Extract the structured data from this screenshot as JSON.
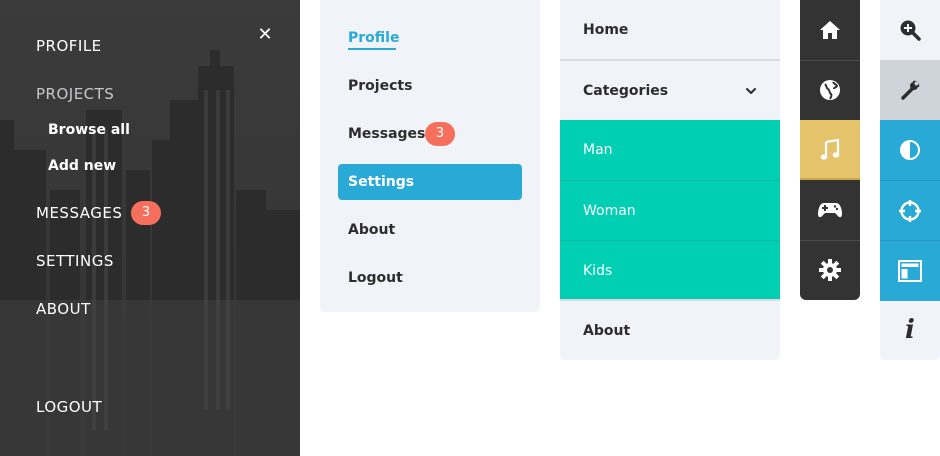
{
  "panel1": {
    "close_icon": "close-icon",
    "items": [
      {
        "label": "PROFILE"
      },
      {
        "label": "PROJECTS"
      },
      {
        "label": "MESSAGES",
        "badge": "3"
      },
      {
        "label": "SETTINGS"
      },
      {
        "label": "ABOUT"
      },
      {
        "label": "LOGOUT"
      }
    ],
    "sub_items": [
      {
        "label": "Browse all"
      },
      {
        "label": "Add new"
      }
    ]
  },
  "panel2": {
    "items": [
      {
        "label": "Profile",
        "state": "active"
      },
      {
        "label": "Projects"
      },
      {
        "label": "Messages",
        "badge": "3"
      },
      {
        "label": "Settings",
        "state": "selected"
      },
      {
        "label": "About"
      },
      {
        "label": "Logout"
      }
    ]
  },
  "panel3": {
    "items": [
      {
        "label": "Home"
      },
      {
        "label": "Categories",
        "icon": "chevron-down-icon"
      },
      {
        "label": "Man"
      },
      {
        "label": "Woman"
      },
      {
        "label": "Kids"
      },
      {
        "label": "About"
      }
    ]
  },
  "panel4": {
    "icons": [
      "home-icon",
      "globe-icon",
      "music-icon",
      "gamepad-icon",
      "gear-icon"
    ],
    "active": "music-icon"
  },
  "panel5": {
    "icons": [
      "zoom-in-icon",
      "wrench-icon",
      "contrast-icon",
      "crosshair-icon",
      "layout-icon",
      "info-icon"
    ],
    "info_glyph": "i"
  },
  "colors": {
    "accent_blue": "#29a9d6",
    "teal": "#00cfb4",
    "badge_red": "#f56f5c",
    "yellow_active": "#e5c36b",
    "dark": "#333333",
    "light_bg": "#f0f3f7"
  }
}
